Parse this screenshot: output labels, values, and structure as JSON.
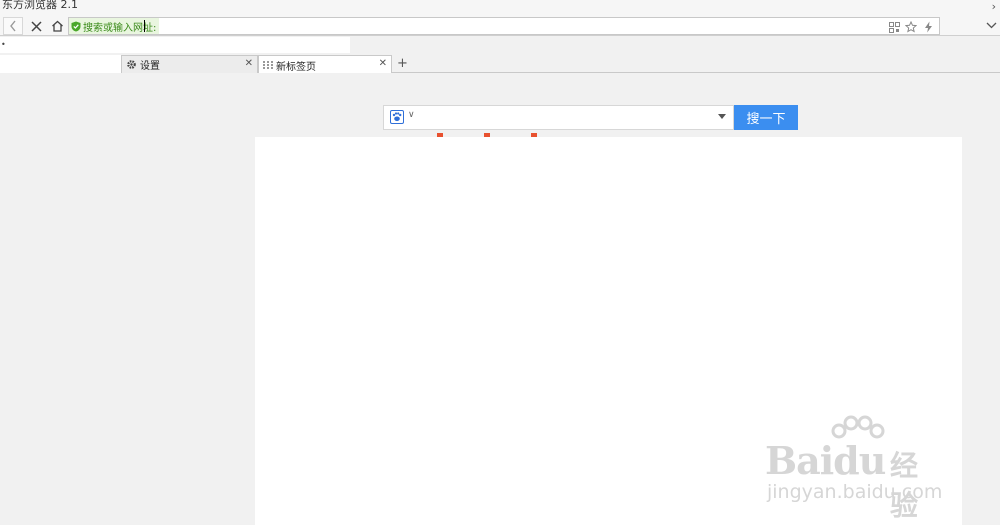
{
  "window": {
    "title": "东方浏览器 2.1"
  },
  "address_bar": {
    "hint": "搜索或输入网址:",
    "value": ""
  },
  "tabs": [
    {
      "label": ""
    },
    {
      "label": "设置"
    },
    {
      "label": "新标签页"
    }
  ],
  "search": {
    "button_label": "搜一下",
    "placeholder": ""
  },
  "watermark": {
    "logo": "Baidu",
    "cn": "经验",
    "url": "jingyan.baidu.com"
  },
  "colors": {
    "accent": "#3b8ef0",
    "secure_hint_bg": "#e9f6df",
    "secure_hint_text": "#3a8a1a",
    "marker_red": "#e8512f"
  },
  "icons": [
    "chevron-left-icon",
    "close-icon",
    "home-icon",
    "shield-check-icon",
    "qr-code-icon",
    "star-icon",
    "lightning-icon",
    "chevron-down-icon",
    "gear-icon",
    "grid-icon",
    "plus-icon",
    "paw-icon"
  ]
}
